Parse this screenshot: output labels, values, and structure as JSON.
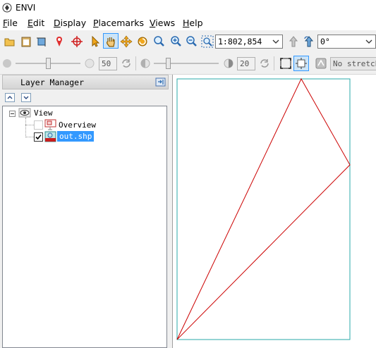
{
  "window": {
    "title": "ENVI"
  },
  "menu": [
    {
      "label": "File",
      "ul": "F",
      "rest": "ile"
    },
    {
      "label": "Edit",
      "ul": "E",
      "rest": "dit"
    },
    {
      "label": "Display",
      "ul": "D",
      "rest": "isplay"
    },
    {
      "label": "Placemarks",
      "ul": "P",
      "rest": "lacemarks"
    },
    {
      "label": "Views",
      "ul": "V",
      "rest": "iews"
    },
    {
      "label": "Help",
      "ul": "H",
      "rest": "elp"
    }
  ],
  "toolbar": {
    "icons": [
      "open-icon",
      "clipboard-icon",
      "crop-icon",
      "placemark-pin-icon",
      "crosshair-icon",
      "select-arrow-icon",
      "pan-hand-icon",
      "fly-icon",
      "rotate-icon",
      "zoom-icon",
      "zoom-in-icon",
      "zoom-out-icon",
      "zoom-fit-icon"
    ],
    "scale_value": "1:802,854",
    "rotation_value": "0°"
  },
  "toolbar2": {
    "brightness_value": "50",
    "contrast_value": "20",
    "stretch_value": "No stretch"
  },
  "layer_manager": {
    "title": "Layer Manager",
    "tree": {
      "root": "View",
      "items": [
        {
          "label": "Overview",
          "checked": false,
          "selected": false
        },
        {
          "label": "out.shp",
          "checked": true,
          "selected": true
        }
      ]
    }
  },
  "colors": {
    "frame": "#2aa8a8",
    "vector_line": "#cc0000",
    "selection": "#3399ff"
  }
}
